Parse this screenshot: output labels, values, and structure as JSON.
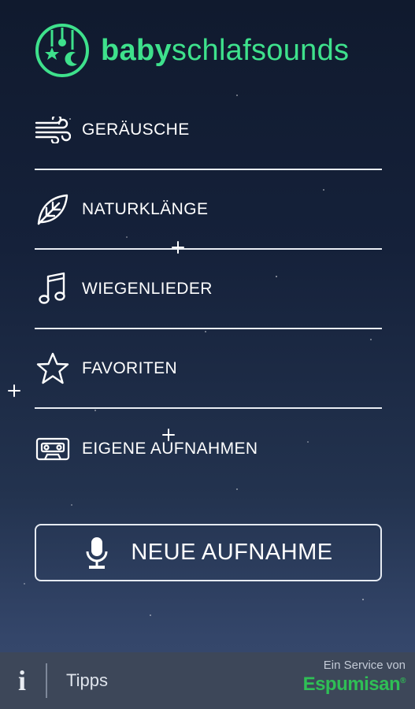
{
  "logo": {
    "bold": "baby",
    "regular": "schlafsounds"
  },
  "menu": {
    "items": [
      {
        "label": "GERÄUSCHE",
        "icon": "wind-icon"
      },
      {
        "label": "NATURKLÄNGE",
        "icon": "leaf-icon"
      },
      {
        "label": "WIEGENLIEDER",
        "icon": "music-note-icon"
      },
      {
        "label": "FAVORITEN",
        "icon": "star-icon"
      },
      {
        "label": "EIGENE AUFNAHMEN",
        "icon": "cassette-icon"
      }
    ]
  },
  "record_button": {
    "label": "NEUE AUFNAHME",
    "icon": "microphone-icon"
  },
  "bottom_bar": {
    "info_icon": "i",
    "tips_label": "Tipps",
    "service_text": "Ein Service von",
    "brand_name": "Espumisan",
    "brand_mark": "®"
  },
  "colors": {
    "accent": "#3ee18c",
    "brand": "#2fbf55",
    "bar": "#3d4759",
    "sky_top": "#101a2e",
    "sky_bottom": "#3a4c70"
  }
}
